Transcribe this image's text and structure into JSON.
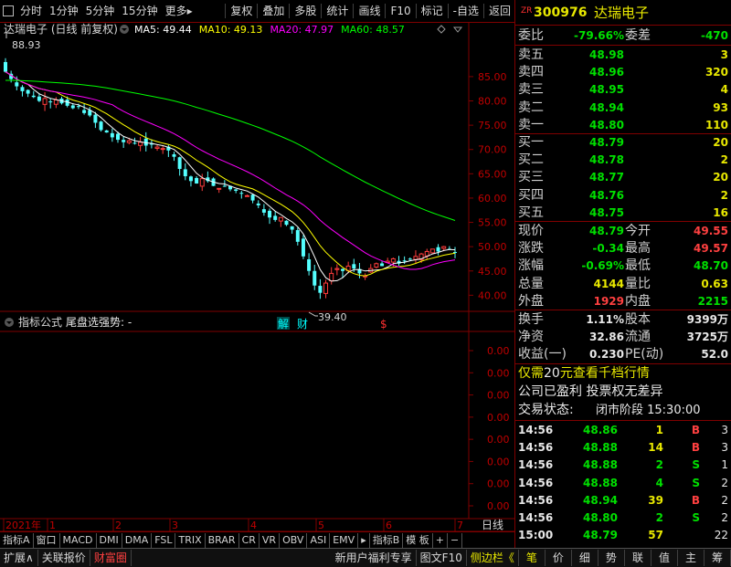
{
  "toolbar": {
    "items": [
      "分时",
      "1分钟",
      "5分钟",
      "15分钟",
      "更多"
    ],
    "more_arrow": "▸",
    "right_items": [
      "复权",
      "叠加",
      "多股",
      "统计",
      "画线",
      "F10",
      "标记",
      "-自选",
      "返回"
    ]
  },
  "chart": {
    "title": "达瑞电子 (日线 前复权)",
    "ma_labels": [
      {
        "text": "MA5: 49.44",
        "color": "#ffffff"
      },
      {
        "text": "MA10: 49.13",
        "color": "#ffff00"
      },
      {
        "text": "MA20: 47.97",
        "color": "#ff00ff"
      },
      {
        "text": "MA60: 48.57",
        "color": "#00ff00"
      }
    ],
    "high_label": "88.93",
    "low_label": "39.40",
    "price_axis": [
      "85.00",
      "80.00",
      "75.00",
      "70.00",
      "65.00",
      "60.00",
      "55.00",
      "50.00",
      "45.00",
      "40.00"
    ],
    "event_markers": [
      "解",
      "财",
      "$"
    ],
    "indicator_title": "指标公式",
    "indicator_name": "尾盘选强势: -",
    "indicator_axis": [
      "0.00",
      "0.00",
      "0.00",
      "0.00",
      "0.00",
      "0.00",
      "0.00",
      "0.00"
    ],
    "date_axis": [
      "2021年",
      "1",
      "2",
      "3",
      "4",
      "5",
      "6",
      "7"
    ],
    "date_axis_right": "日线",
    "scale_controls": [
      "+",
      "−"
    ]
  },
  "chart_data": {
    "type": "candlestick",
    "title": "达瑞电子 (日线 前复权)",
    "ylim": [
      38,
      88.93
    ],
    "high": 88.93,
    "low": 39.4,
    "close_series_approx": [
      86.0,
      84.5,
      83.0,
      82.0,
      81.5,
      80.8,
      80.0,
      80.5,
      79.8,
      80.2,
      79.5,
      79.0,
      78.5,
      78.8,
      77.5,
      77.0,
      75.5,
      74.0,
      73.5,
      72.5,
      72.0,
      71.5,
      71.8,
      71.2,
      71.5,
      70.8,
      71.0,
      70.5,
      70.2,
      69.8,
      68.5,
      66.0,
      64.5,
      63.5,
      63.0,
      64.0,
      63.5,
      62.5,
      62.0,
      62.5,
      61.8,
      61.5,
      61.0,
      60.5,
      59.5,
      58.5,
      57.0,
      56.0,
      55.5,
      56.0,
      54.5,
      53.5,
      51.0,
      48.0,
      45.0,
      42.0,
      40.5,
      42.5,
      44.5,
      45.5,
      45.0,
      46.0,
      45.5,
      44.5,
      44.0,
      45.5,
      46.5,
      46.0,
      47.0,
      47.5,
      46.5,
      47.0,
      47.5,
      48.0,
      48.5,
      49.0,
      49.5,
      49.0,
      50.0,
      49.5,
      48.79
    ],
    "ma5_last": 49.44,
    "ma10_last": 49.13,
    "ma20_last": 47.97,
    "ma60_last": 48.57,
    "months": [
      "2021年",
      "1",
      "2",
      "3",
      "4",
      "5",
      "6",
      "7"
    ]
  },
  "stock": {
    "code_prefix": "ZR",
    "code": "300976",
    "name": "达瑞电子"
  },
  "weibi": {
    "l1": "委比",
    "v1": "-79.66%",
    "l2": "委差",
    "v2": "-470"
  },
  "asks": [
    {
      "label": "卖五",
      "price": "48.98",
      "vol": "3"
    },
    {
      "label": "卖四",
      "price": "48.96",
      "vol": "320"
    },
    {
      "label": "卖三",
      "price": "48.95",
      "vol": "4"
    },
    {
      "label": "卖二",
      "price": "48.94",
      "vol": "93"
    },
    {
      "label": "卖一",
      "price": "48.80",
      "vol": "110"
    }
  ],
  "bids": [
    {
      "label": "买一",
      "price": "48.79",
      "vol": "20"
    },
    {
      "label": "买二",
      "price": "48.78",
      "vol": "2"
    },
    {
      "label": "买三",
      "price": "48.77",
      "vol": "20"
    },
    {
      "label": "买四",
      "price": "48.76",
      "vol": "2"
    },
    {
      "label": "买五",
      "price": "48.75",
      "vol": "16"
    }
  ],
  "quote": [
    {
      "l1": "现价",
      "v1": "48.79",
      "c1": "g",
      "l2": "今开",
      "v2": "49.55",
      "c2": "r"
    },
    {
      "l1": "涨跌",
      "v1": "-0.34",
      "c1": "g",
      "l2": "最高",
      "v2": "49.57",
      "c2": "r"
    },
    {
      "l1": "涨幅",
      "v1": "-0.69%",
      "c1": "g",
      "l2": "最低",
      "v2": "48.70",
      "c2": "g"
    },
    {
      "l1": "总量",
      "v1": "4144",
      "c1": "y",
      "l2": "量比",
      "v2": "0.63",
      "c2": "y"
    },
    {
      "l1": "外盘",
      "v1": "1929",
      "c1": "r",
      "l2": "内盘",
      "v2": "2215",
      "c2": "g"
    }
  ],
  "finance": [
    {
      "l1": "换手",
      "v1": "1.11%",
      "l2": "股本",
      "v2": "9399万"
    },
    {
      "l1": "净资",
      "v1": "32.86",
      "l2": "流通",
      "v2": "3725万"
    },
    {
      "l1": "收益(一)",
      "v1": "0.230",
      "l2": "PE(动)",
      "v2": "52.0"
    }
  ],
  "promo": {
    "pre": "仅需",
    "num": "20",
    "post": "元查看千档行情",
    "line2": "公司已盈利 投票权无差异",
    "status_label": "交易状态:",
    "status_value": "闭市阶段 15:30:00"
  },
  "ticks": [
    {
      "time": "14:56",
      "price": "48.86",
      "vol": "1",
      "side": "B",
      "n": "3"
    },
    {
      "time": "14:56",
      "price": "48.88",
      "vol": "14",
      "side": "B",
      "n": "3"
    },
    {
      "time": "14:56",
      "price": "48.88",
      "vol": "2",
      "side": "S",
      "n": "1"
    },
    {
      "time": "14:56",
      "price": "48.88",
      "vol": "4",
      "side": "S",
      "n": "2"
    },
    {
      "time": "14:56",
      "price": "48.94",
      "vol": "39",
      "side": "B",
      "n": "2"
    },
    {
      "time": "14:56",
      "price": "48.80",
      "vol": "2",
      "side": "S",
      "n": "2"
    },
    {
      "time": "15:00",
      "price": "48.79",
      "vol": "57",
      "side": "",
      "n": "22"
    }
  ],
  "bottom_tabs": [
    "指标A",
    "窗口",
    "MACD",
    "DMI",
    "DMA",
    "FSL",
    "TRIX",
    "BRAR",
    "CR",
    "VR",
    "OBV",
    "ASI",
    "EMV",
    "▸",
    "指标B",
    "模 板",
    "+",
    "−"
  ],
  "bottom_bar": {
    "left": [
      "扩展∧",
      "关联报价",
      "财富圈"
    ],
    "mid": [
      "新用户福利专享",
      "图文F10",
      "侧边栏《"
    ],
    "right": [
      "笔",
      "价",
      "细",
      "势",
      "联",
      "值",
      "主",
      "筹"
    ]
  },
  "colors": {
    "up": "#ff3c3c",
    "down": "#54ffff",
    "border": "#800000"
  }
}
